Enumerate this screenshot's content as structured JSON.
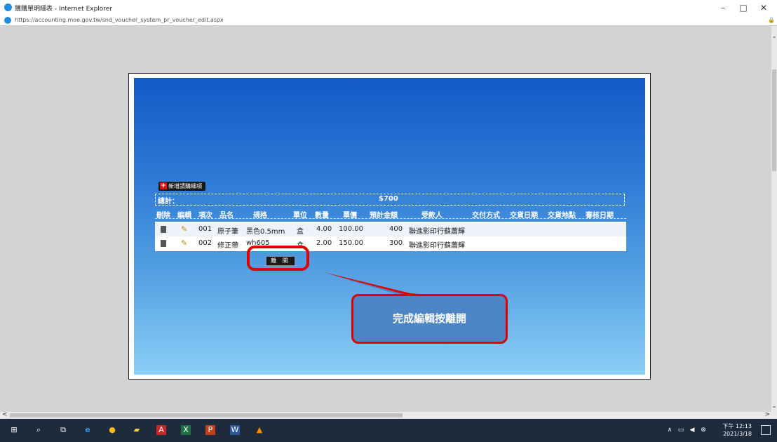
{
  "window": {
    "title": "購購單明細表 - Internet Explorer",
    "url": "https://accounting.moe.gov.tw/snd_voucher_system_pr_voucher_edit.aspx",
    "minimize": "–",
    "maximize": "□",
    "close": "✕"
  },
  "dialog": {
    "add_item_label": "新增請購細項",
    "total_label": "總計：",
    "total_amount": "$700",
    "columns": [
      "刪除",
      "編輯",
      "項次",
      "品名",
      "規格",
      "單位",
      "數量",
      "單價",
      "預計金額",
      "受款人",
      "交付方式",
      "交貨日期",
      "交貨地點",
      "審核日期"
    ],
    "rows": [
      {
        "item_no": "001",
        "name": "原子筆",
        "spec": "黑色0.5mm",
        "unit": "盒",
        "qty": "4.00",
        "price": "100.00",
        "amount": "400",
        "payee": "聯進影印行蘇蕭輝"
      },
      {
        "item_no": "002",
        "name": "修正帶",
        "spec": "wh605",
        "unit": "盒",
        "qty": "2.00",
        "price": "150.00",
        "amount": "300",
        "payee": "聯進影印行蘇蕭輝"
      }
    ],
    "leave_label": "離 開"
  },
  "annotation": {
    "callout_text": "完成編輯按離開",
    "highlight_color": "#e00000"
  },
  "taskbar": {
    "icons": [
      "windows-start",
      "search",
      "task-view",
      "internet-explorer",
      "chrome",
      "file-explorer",
      "acrobat",
      "excel",
      "powerpoint",
      "word",
      "vlc"
    ],
    "time": "下午 12:13",
    "date": "2021/3/18"
  }
}
